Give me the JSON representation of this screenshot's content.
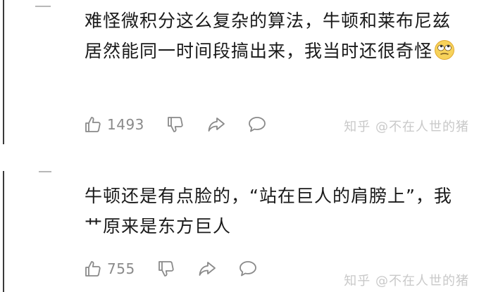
{
  "comments": [
    {
      "text": "难怪微积分这么复杂的算法，牛顿和莱布尼兹居然能同一时间段搞出来，我当时还很奇怪",
      "emoji": "rolling-eyes-emoji",
      "likes": "1493",
      "watermark": "知乎 @不在人世的猪"
    },
    {
      "text": "牛顿还是有点脸的，“站在巨人的肩膀上”，我艹原来是东方巨人",
      "likes": "755",
      "watermark": "知乎 @不在人世的猪"
    }
  ],
  "colors": {
    "text": "#1a1a1a",
    "meta": "#8a8a8a",
    "watermark": "#c9c9c9",
    "rule": "#3a3a3a"
  }
}
